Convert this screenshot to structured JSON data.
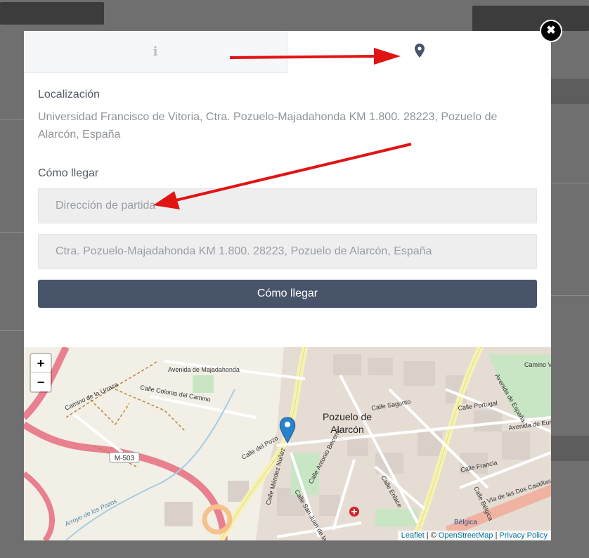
{
  "background": {
    "dim_color": "#6f6f6f"
  },
  "modal": {
    "tabs": [
      {
        "name": "info",
        "icon": "info-icon",
        "glyph": "i",
        "active": false
      },
      {
        "name": "location",
        "icon": "map-marker-icon",
        "active": true
      }
    ],
    "close_glyph": "✖",
    "location_label": "Localización",
    "address": "Universidad Francisco de Vitoria, Ctra. Pozuelo-Majadahonda KM 1.800. 28223, Pozuelo de Alarcón, España",
    "directions_label": "Cómo llegar",
    "from_placeholder": "Dirección de partida",
    "to_value": "Ctra. Pozuelo-Majadahonda KM 1.800. 28223, Pozuelo de Alarcón, España",
    "button_label": "Cómo llegar",
    "button_color": "#48546a"
  },
  "map": {
    "zoom_in": "+",
    "zoom_out": "−",
    "town_name_line1": "Pozuelo de",
    "town_name_line2": "Alarcón",
    "streets": [
      "Avenida de Majadahonda",
      "Calle Colonia del Camino",
      "Camino de la Urraca",
      "Calle Sagunto",
      "Calle Portugal",
      "Avenida de España",
      "Avenida de Europa",
      "Calle Francia",
      "Calle del Pozo",
      "Calle Antonio Becerril",
      "Calle Méndez Núñez",
      "Calle San Juan de la Cruz",
      "Calle Enlace",
      "Calle Bélgica",
      "Vía de las Dos Castillas",
      "Arroyo de los Pozos",
      "Camino Va",
      "Bélgica",
      "M-503"
    ],
    "attribution": {
      "leaflet": "Leaflet",
      "sep1": " | © ",
      "osm": "OpenStreetMap",
      "sep2": " | ",
      "privacy": "Privacy Policy"
    },
    "marker_color": "#2a81cb"
  },
  "annotations": {
    "arrow_color": "#e11414"
  }
}
